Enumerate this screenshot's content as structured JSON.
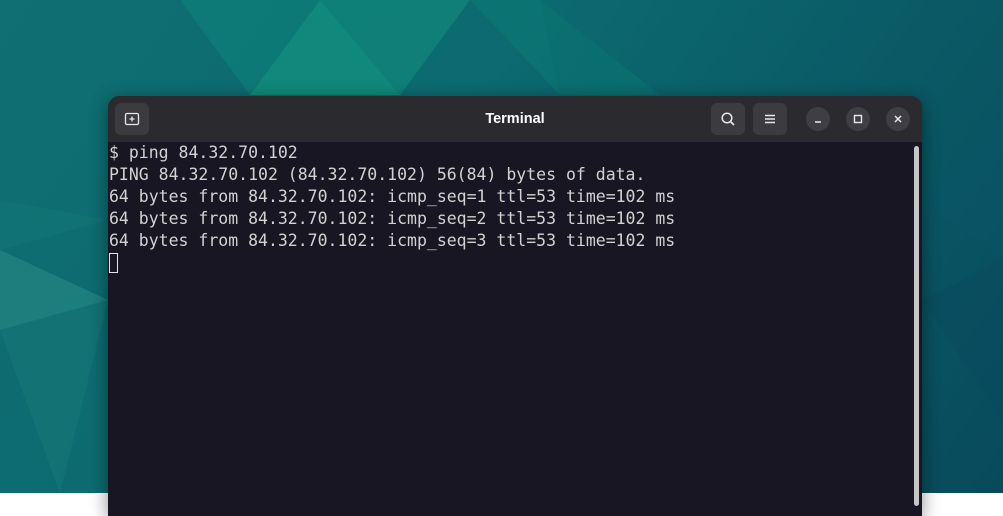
{
  "window": {
    "title": "Terminal",
    "buttons": {
      "new_tab": "new-tab-icon",
      "search": "search-icon",
      "menu": "hamburger-menu-icon",
      "minimize": "minimize-icon",
      "maximize": "maximize-icon",
      "close": "close-icon"
    }
  },
  "terminal": {
    "lines": [
      "$ ping 84.32.70.102",
      "PING 84.32.70.102 (84.32.70.102) 56(84) bytes of data.",
      "64 bytes from 84.32.70.102: icmp_seq=1 ttl=53 time=102 ms",
      "64 bytes from 84.32.70.102: icmp_seq=2 ttl=53 time=102 ms",
      "64 bytes from 84.32.70.102: icmp_seq=3 ttl=53 time=102 ms"
    ]
  },
  "colors": {
    "terminal_bg": "#181622",
    "titlebar_bg": "#2b2a2f",
    "text": "#d2d2d2",
    "desktop": "#0c6a70"
  }
}
